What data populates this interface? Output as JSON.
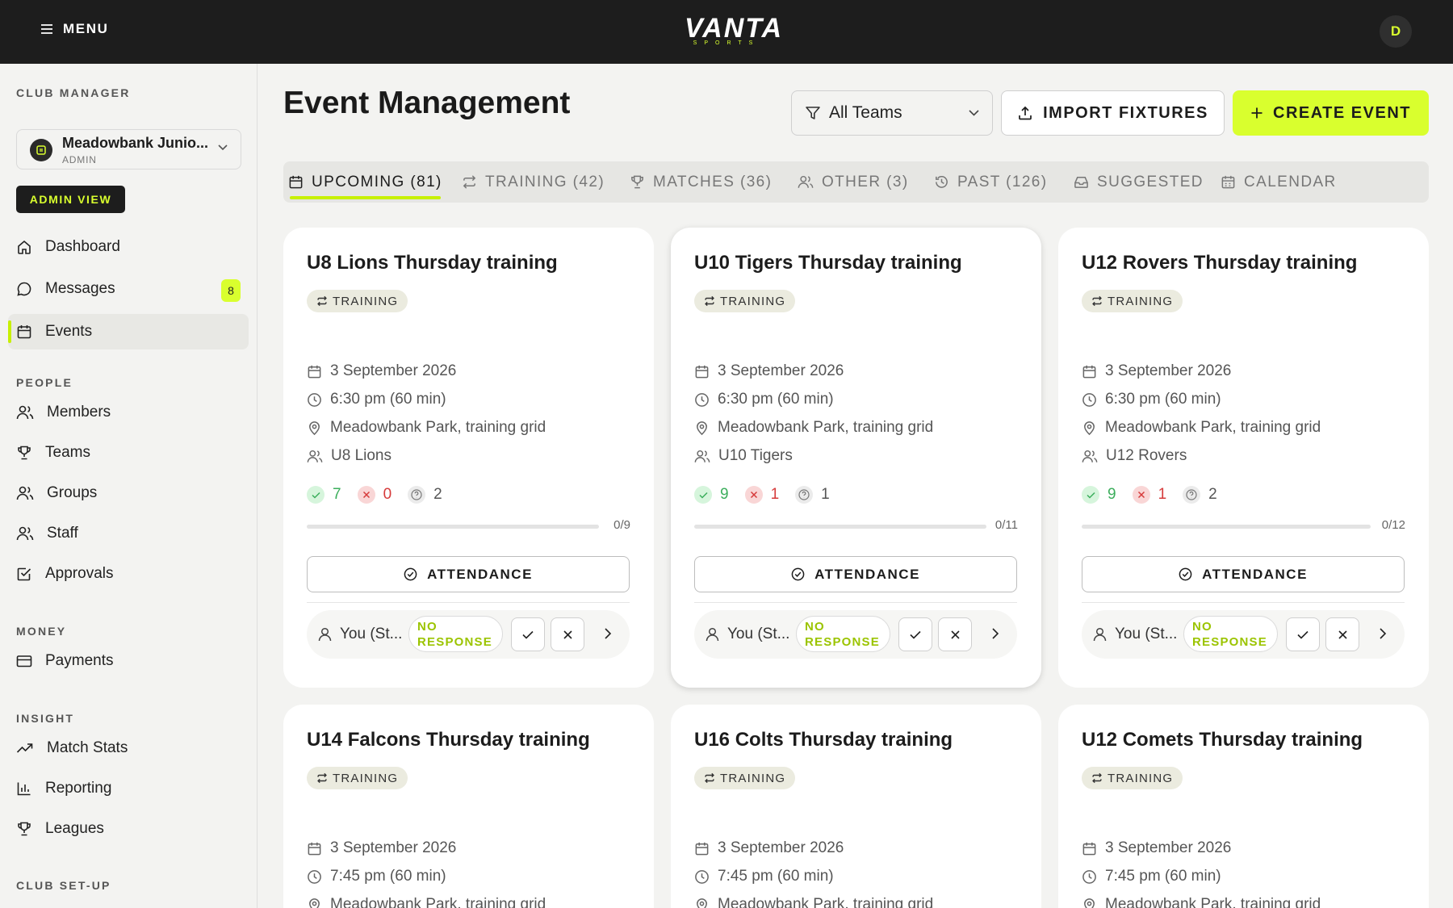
{
  "topbar": {
    "menu_label": "MENU",
    "logo_text": "VANTA",
    "logo_sub": "SPORTS",
    "avatar_initial": "D"
  },
  "sidebar": {
    "club_manager_title": "CLUB MANAGER",
    "club": {
      "name": "Meadowbank Junio...",
      "role": "ADMIN"
    },
    "admin_view_label": "ADMIN VIEW",
    "main_items": [
      {
        "label": "Dashboard",
        "icon": "home-icon"
      },
      {
        "label": "Messages",
        "icon": "chat-icon",
        "badge": "8"
      },
      {
        "label": "Events",
        "icon": "calendar-icon",
        "active": true
      }
    ],
    "people_title": "PEOPLE",
    "people_items": [
      {
        "label": "Members",
        "icon": "users-icon"
      },
      {
        "label": "Teams",
        "icon": "trophy-icon"
      },
      {
        "label": "Groups",
        "icon": "users-icon"
      },
      {
        "label": "Staff",
        "icon": "users-icon"
      },
      {
        "label": "Approvals",
        "icon": "checkbox-icon"
      }
    ],
    "money_title": "MONEY",
    "money_items": [
      {
        "label": "Payments",
        "icon": "credit-card-icon"
      }
    ],
    "insight_title": "INSIGHT",
    "insight_items": [
      {
        "label": "Match Stats",
        "icon": "trend-icon"
      },
      {
        "label": "Reporting",
        "icon": "bar-chart-icon"
      },
      {
        "label": "Leagues",
        "icon": "trophy-icon"
      }
    ],
    "club_setup_title": "CLUB SET-UP"
  },
  "header": {
    "title": "Event Management",
    "team_filter": "All Teams",
    "import_label": "IMPORT FIXTURES",
    "create_label": "CREATE EVENT"
  },
  "tabs": [
    {
      "label": "UPCOMING (81)",
      "icon": "calendar-icon",
      "active": true
    },
    {
      "label": "TRAINING (42)",
      "icon": "repeat-icon"
    },
    {
      "label": "MATCHES (36)",
      "icon": "trophy-icon"
    },
    {
      "label": "OTHER (3)",
      "icon": "users-icon"
    },
    {
      "label": "PAST (126)",
      "icon": "history-icon"
    },
    {
      "label": "SUGGESTED",
      "icon": "inbox-icon"
    },
    {
      "label": "CALENDAR",
      "icon": "calendar-grid-icon"
    }
  ],
  "events": [
    {
      "title": "U8 Lions Thursday training",
      "tag": "TRAINING",
      "date": "3 September 2026",
      "time": "6:30 pm (60 min)",
      "location": "Meadowbank Park, training grid",
      "team": "U8 Lions",
      "yes": "7",
      "no": "0",
      "maybe": "2",
      "ratio": "0/9",
      "progress": 0,
      "attendance_label": "ATTENDANCE",
      "user": "You (St...",
      "response": "NO RESPONSE"
    },
    {
      "title": "U10 Tigers Thursday training",
      "tag": "TRAINING",
      "date": "3 September 2026",
      "time": "6:30 pm (60 min)",
      "location": "Meadowbank Park, training grid",
      "team": "U10 Tigers",
      "yes": "9",
      "no": "1",
      "maybe": "1",
      "ratio": "0/11",
      "progress": 0,
      "attendance_label": "ATTENDANCE",
      "user": "You (St...",
      "response": "NO RESPONSE"
    },
    {
      "title": "U12 Rovers Thursday training",
      "tag": "TRAINING",
      "date": "3 September 2026",
      "time": "6:30 pm (60 min)",
      "location": "Meadowbank Park, training grid",
      "team": "U12 Rovers",
      "yes": "9",
      "no": "1",
      "maybe": "2",
      "ratio": "0/12",
      "progress": 0,
      "attendance_label": "ATTENDANCE",
      "user": "You (St...",
      "response": "NO RESPONSE"
    },
    {
      "title": "U14 Falcons Thursday training",
      "tag": "TRAINING",
      "date": "3 September 2026",
      "time": "7:45 pm (60 min)",
      "location": "Meadowbank Park, training grid"
    },
    {
      "title": "U16 Colts Thursday training",
      "tag": "TRAINING",
      "date": "3 September 2026",
      "time": "7:45 pm (60 min)",
      "location": "Meadowbank Park, training grid"
    },
    {
      "title": "U12 Comets Thursday training",
      "tag": "TRAINING",
      "date": "3 September 2026",
      "time": "7:45 pm (60 min)",
      "location": "Meadowbank Park, training grid"
    }
  ],
  "colors": {
    "accent": "#d9ff2e",
    "dark": "#1d1d1d",
    "yes": "#3cae5c",
    "no": "#d63b3b"
  }
}
